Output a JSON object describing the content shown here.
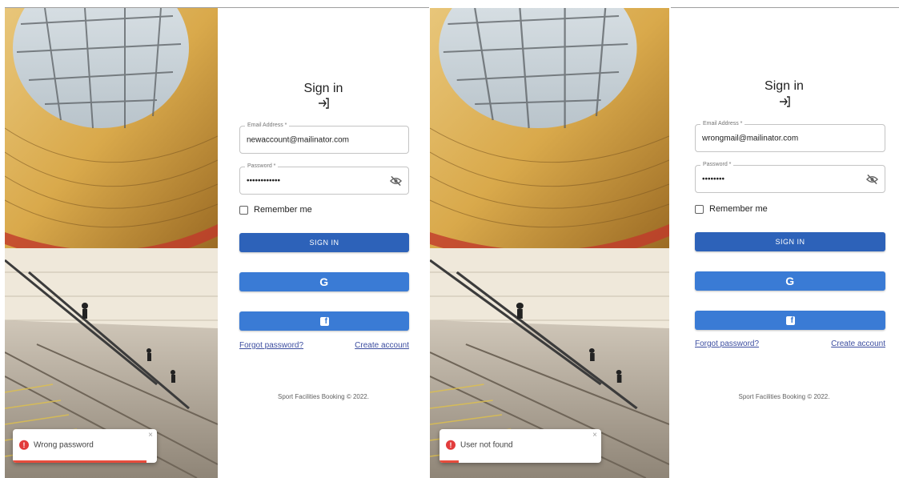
{
  "colors": {
    "primary_button": "#2d62b9",
    "social_button": "#3a7bd5",
    "link": "#3d4ea0",
    "error": "#e23c3c"
  },
  "screens": [
    {
      "title": "Sign in",
      "email": {
        "label": "Email Address *",
        "value": "newaccount@mailinator.com"
      },
      "password": {
        "label": "Password *",
        "value": "••••••••••••"
      },
      "remember_label": "Remember me",
      "sign_in_label": "SIGN IN",
      "google_label": "G",
      "facebook_label": "f",
      "forgot_password": "Forgot password?",
      "create_account": "Create account",
      "footer": "Sport Facilities Booking © 2022.",
      "toast": {
        "message": "Wrong password",
        "icon": "error-icon",
        "close": "×",
        "progress_fraction": 0.93
      }
    },
    {
      "title": "Sign in",
      "email": {
        "label": "Email Address *",
        "value": "wrongmail@mailinator.com"
      },
      "password": {
        "label": "Password *",
        "value": "••••••••"
      },
      "remember_label": "Remember me",
      "sign_in_label": "SIGN IN",
      "google_label": "G",
      "facebook_label": "f",
      "forgot_password": "Forgot password?",
      "create_account": "Create account",
      "footer": "Sport Facilities Booking © 2022.",
      "toast": {
        "message": "User not found",
        "icon": "error-icon",
        "close": "×",
        "progress_fraction": 0.12
      }
    }
  ]
}
